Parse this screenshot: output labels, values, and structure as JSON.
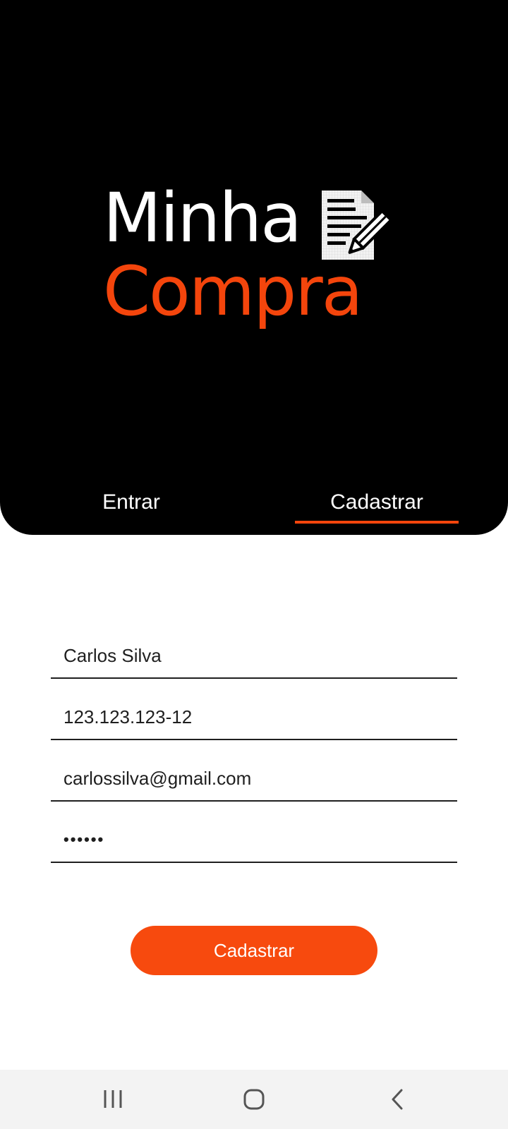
{
  "app": {
    "logo": {
      "line1": "Minha",
      "line2": "Compra",
      "icon": "document-pencil-icon",
      "colors": {
        "line1": "#ffffff",
        "line2": "#f4450c"
      }
    }
  },
  "tabs": {
    "items": [
      {
        "label": "Entrar",
        "selected": false
      },
      {
        "label": "Cadastrar",
        "selected": true
      }
    ],
    "indicator_color": "#f4450c"
  },
  "form": {
    "name": {
      "value": "Carlos Silva"
    },
    "cpf": {
      "value": "123.123.123-12"
    },
    "email": {
      "value": "carlossilva@gmail.com"
    },
    "password": {
      "value": "••••••",
      "masked": true
    },
    "submit_label": "Cadastrar",
    "submit_color": "#f74a0e"
  },
  "system_nav": {
    "buttons": [
      {
        "icon": "recent-apps-icon"
      },
      {
        "icon": "home-icon"
      },
      {
        "icon": "back-icon"
      }
    ]
  }
}
